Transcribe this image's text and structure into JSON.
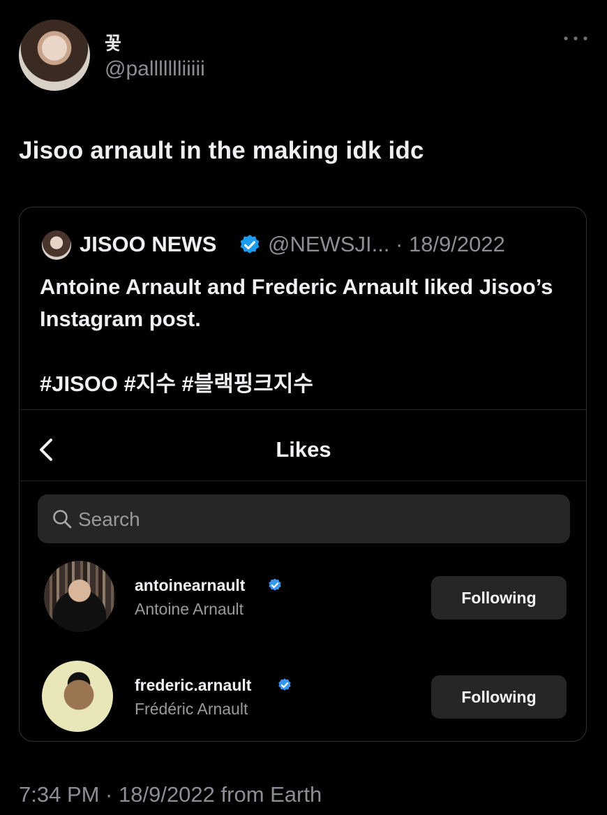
{
  "tweet": {
    "display_name": "꽃",
    "handle": "@pallllllliiiii",
    "text": "Jisoo arnault in the making idk idc",
    "timestamp": "7:34 PM · 18/9/2022 from Earth"
  },
  "quote": {
    "name": "JISOO NEWS",
    "handle_date": "@NEWSJI... · 18/9/2022",
    "body": "Antoine Arnault and Frederic Arnault liked Jisoo’s Instagram post.",
    "hashtags": "#JISOO #지수 #블랙핑크지수"
  },
  "likes_screen": {
    "title": "Likes",
    "search": {
      "placeholder": "Search"
    },
    "users": [
      {
        "username": "antoinearnault",
        "full_name": "Antoine Arnault",
        "button": "Following",
        "verified": true
      },
      {
        "username": "frederic.arnault",
        "full_name": "Frédéric Arnault",
        "button": "Following",
        "verified": true
      }
    ]
  },
  "icons": {
    "more": "ellipsis-icon",
    "verified": "verified-badge-icon",
    "back": "chevron-left-icon",
    "search": "search-icon"
  },
  "colors": {
    "background": "#000000",
    "verified_blue": "#1d9bf0",
    "muted_text": "#8b8f95",
    "button_bg": "#262626"
  }
}
